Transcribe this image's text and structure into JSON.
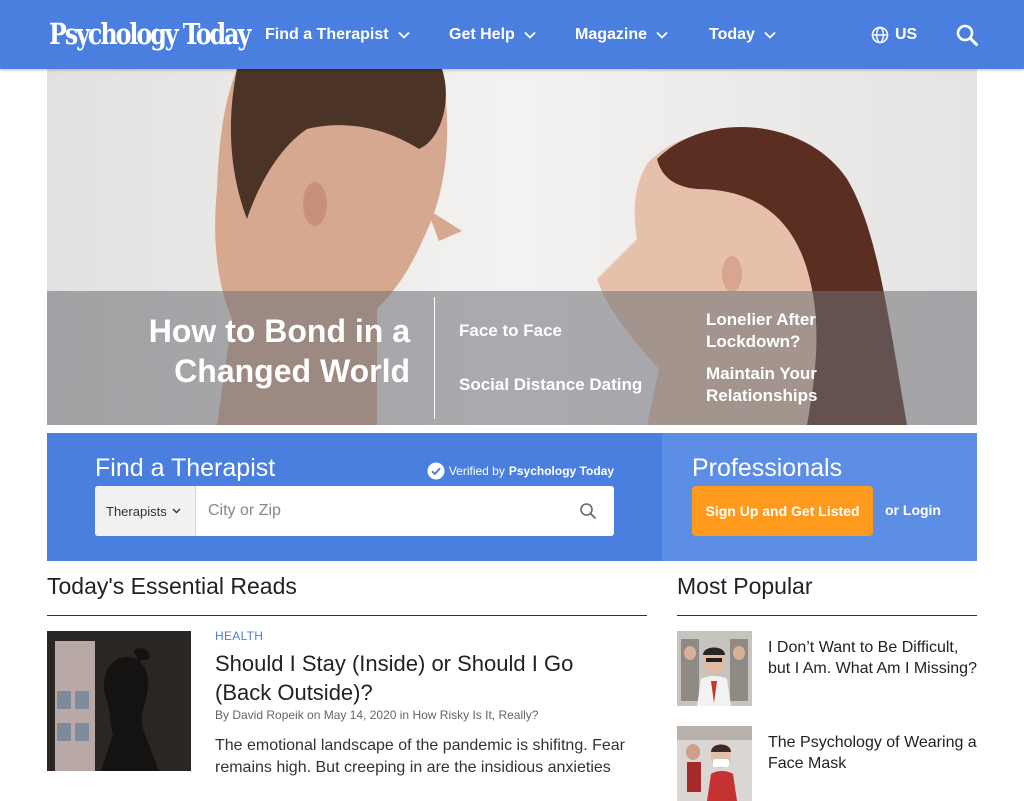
{
  "brand": {
    "logo_text": "Psychology Today",
    "nav_color": "#4a7fe0",
    "accent_orange": "#ff9a1c"
  },
  "nav": {
    "items": [
      {
        "label": "Find a Therapist"
      },
      {
        "label": "Get Help"
      },
      {
        "label": "Magazine"
      },
      {
        "label": "Today"
      }
    ],
    "region": "US",
    "region_icon": "globe-icon",
    "search_icon": "search-icon"
  },
  "hero": {
    "title": "How to Bond in a Changed World",
    "links": [
      "Face to Face",
      "Social Distance Dating",
      "Lonelier After Lockdown?",
      "Maintain Your Relationships"
    ]
  },
  "finder": {
    "title": "Find a Therapist",
    "verified_prefix": "Verified by",
    "verified_brand": "Psychology Today",
    "select_value": "Therapists",
    "input_placeholder": "City or Zip"
  },
  "professionals": {
    "title": "Professionals",
    "signup_label": "Sign Up and Get Listed",
    "login_label": "or Login"
  },
  "essential_reads": {
    "heading": "Today's Essential Reads",
    "articles": [
      {
        "category": "HEALTH",
        "title": "Should I Stay (Inside) or Should I Go (Back Outside)?",
        "byline": "By David Ropeik on May 14, 2020 in How Risky Is It, Really?",
        "excerpt": "The emotional landscape of the pandemic is shifitng. Fear remains high. But creeping in are the insidious anxieties"
      }
    ]
  },
  "most_popular": {
    "heading": "Most Popular",
    "items": [
      {
        "title": "I Don’t Want to Be Difficult, but I Am. What Am I Missing?"
      },
      {
        "title": "The Psychology of Wearing a Face Mask"
      }
    ]
  }
}
